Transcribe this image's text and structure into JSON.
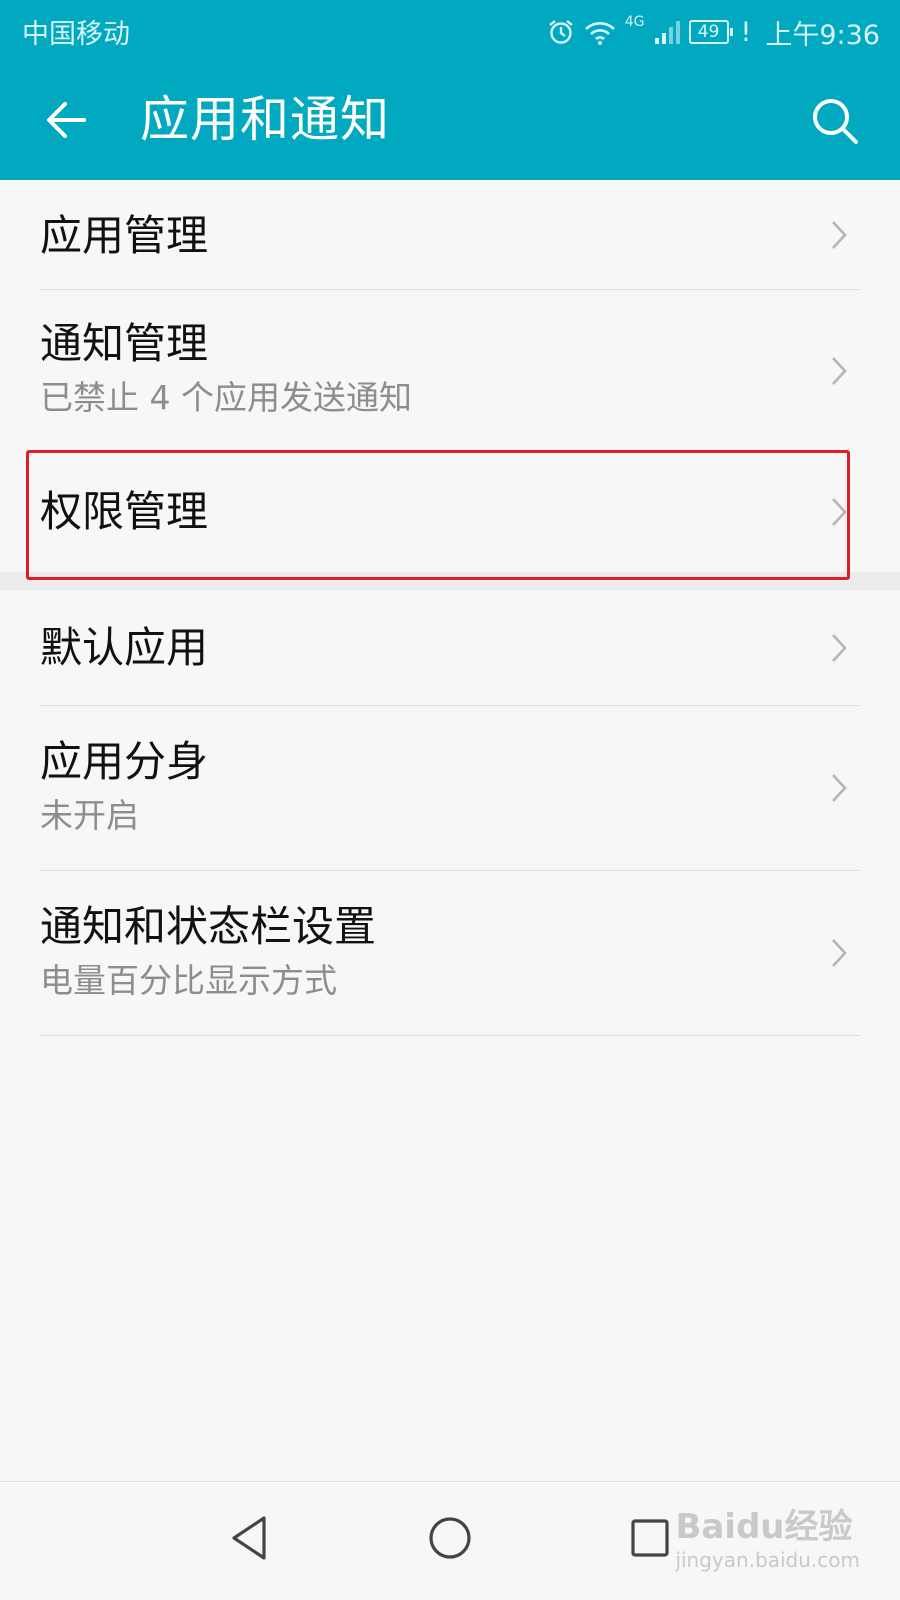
{
  "status_bar": {
    "carrier": "中国移动",
    "alarm_icon": "alarm-clock-icon",
    "wifi_icon": "wifi-icon",
    "network_type": "4G",
    "signal_icon": "cell-signal-icon",
    "battery_level": "49",
    "alert_mark": "!",
    "time": "上午9:36"
  },
  "header": {
    "back_icon": "back-arrow-icon",
    "title": "应用和通知",
    "search_icon": "search-icon",
    "background_color": "#00a9c0"
  },
  "menu": {
    "items": [
      {
        "label": "应用管理",
        "subtitle": ""
      },
      {
        "label": "通知管理",
        "subtitle": "已禁止 4 个应用发送通知"
      },
      {
        "label": "权限管理",
        "subtitle": ""
      },
      {
        "label": "默认应用",
        "subtitle": ""
      },
      {
        "label": "应用分身",
        "subtitle": "未开启"
      },
      {
        "label": "通知和状态栏设置",
        "subtitle": "电量百分比显示方式"
      }
    ],
    "highlight_color": "#e01c24"
  },
  "nav_bar": {
    "back_icon": "nav-back-triangle-icon",
    "home_icon": "nav-home-circle-icon",
    "recents_icon": "nav-recents-square-icon"
  },
  "watermark": {
    "brand": "Baidu经验",
    "url": "jingyan.baidu.com"
  }
}
